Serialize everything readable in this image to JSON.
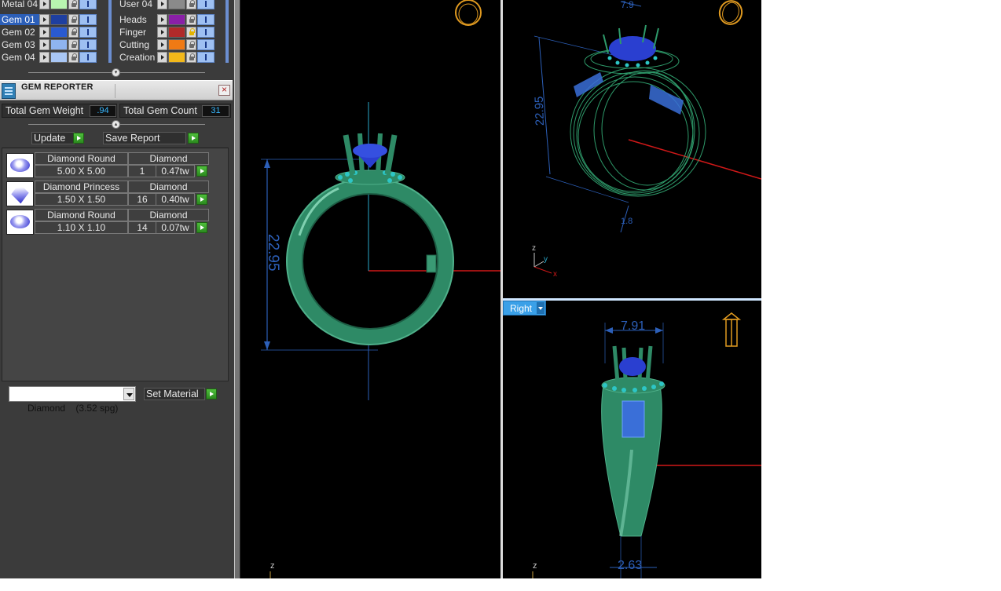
{
  "layers": [
    {
      "name": "Metal 04",
      "color": "#b8f5b0",
      "locked": false,
      "selected": false
    },
    {
      "name": "Gem 01",
      "color": "#1e3fa0",
      "locked": false,
      "selected": true
    },
    {
      "name": "Gem 02",
      "color": "#2a5ad0",
      "locked": false,
      "selected": false
    },
    {
      "name": "Gem 03",
      "color": "#8fb4f0",
      "locked": false,
      "selected": false
    },
    {
      "name": "Gem 04",
      "color": "#a9c7f5",
      "locked": false,
      "selected": false
    },
    {
      "name": "User 04",
      "color": "#8a8a8a",
      "locked": false,
      "selected": false
    },
    {
      "name": "Heads",
      "color": "#8a1fa8",
      "locked": false,
      "selected": false
    },
    {
      "name": "Finger",
      "color": "#b02a2a",
      "locked": true,
      "selected": false
    },
    {
      "name": "Cutting",
      "color": "#f07a14",
      "locked": false,
      "selected": false
    },
    {
      "name": "Creation",
      "color": "#f2b81a",
      "locked": false,
      "selected": false
    }
  ],
  "gem_reporter": {
    "title": "GEM REPORTER",
    "total_weight_label": "Total Gem Weight",
    "total_weight_value": ".94",
    "total_count_label": "Total Gem Count",
    "total_count_value": "31",
    "update_label": "Update",
    "save_report_label": "Save Report",
    "gems": [
      {
        "shape": "Diamond Round",
        "material": "Diamond",
        "size": "5.00 X 5.00",
        "count": "1",
        "weight": "0.47tw",
        "thumb": "round"
      },
      {
        "shape": "Diamond Princess",
        "material": "Diamond",
        "size": "1.50 X 1.50",
        "count": "16",
        "weight": "0.40tw",
        "thumb": "princess"
      },
      {
        "shape": "Diamond Round",
        "material": "Diamond",
        "size": "1.10 X 1.10",
        "count": "14",
        "weight": "0.07tw",
        "thumb": "round"
      }
    ],
    "material_select": "Diamond    (3.52 spg)",
    "set_material_label": "Set Material"
  },
  "viewports": {
    "front": {
      "dimension": "22.95",
      "axis_label": "z"
    },
    "perspective": {
      "dimension_height": "22.95",
      "dimension_top": "7.9",
      "dimension_bottom": "1.8",
      "axis_z": "z",
      "axis_y": "y",
      "axis_x": "x"
    },
    "right": {
      "view_name": "Right",
      "dimension_top": "7.91",
      "dimension_bottom": "2.63",
      "axis_label": "z"
    }
  },
  "colors": {
    "ring_green": "#2e8a66",
    "gem_blue": "#2a3fd0",
    "dimension_blue": "#2c5fb8",
    "axis_red": "#d01818",
    "accent_blue": "#3aa0e8",
    "gizmo_orange": "#e09a20"
  }
}
